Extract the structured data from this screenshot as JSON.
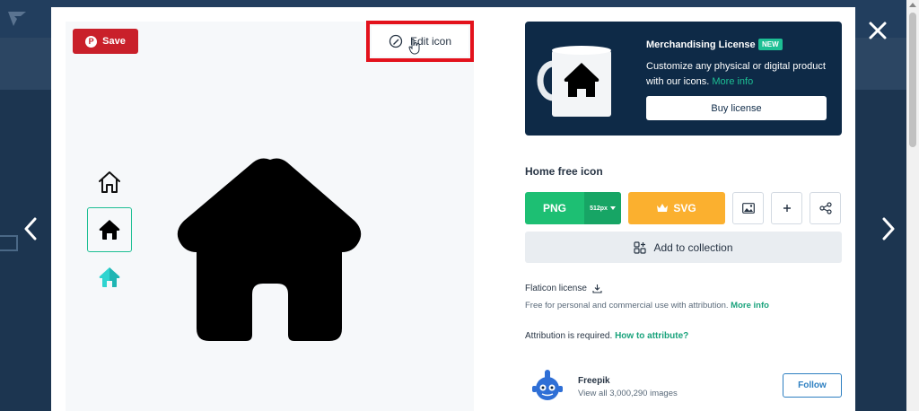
{
  "preview": {
    "save_label": "Save",
    "edit_label": "Edit icon"
  },
  "merch": {
    "title": "Merchandising License",
    "badge": "NEW",
    "desc": "Customize any physical or digital product with our icons.",
    "more_info": "More info",
    "buy_label": "Buy license"
  },
  "icon_title": "Home free icon",
  "download": {
    "png_label": "PNG",
    "png_size": "512px",
    "svg_label": "SVG"
  },
  "collection_label": "Add to collection",
  "license": {
    "title": "Flaticon license",
    "desc": "Free for personal and commercial use with attribution.",
    "more_info": "More info",
    "attribution": "Attribution is required.",
    "how_to": "How to attribute?"
  },
  "author": {
    "name": "Freepik",
    "sub": "View all 3,000,290 images",
    "follow_label": "Follow"
  },
  "colors": {
    "accent_green": "#1dbf73",
    "svg_orange": "#fbb02f",
    "pinterest_red": "#c9202a",
    "highlight_red": "#e3121c",
    "merch_navy": "#0e2a47",
    "teal_variant": "#2fd4d0"
  },
  "icons": [
    "pinterest-icon",
    "pencil-icon",
    "home-outline-icon",
    "home-solid-icon",
    "home-teal-icon",
    "crown-icon",
    "image-icon",
    "plus-icon",
    "share-icon",
    "collection-icon",
    "download-icon",
    "close-icon",
    "chevron-left-icon",
    "chevron-right-icon"
  ]
}
